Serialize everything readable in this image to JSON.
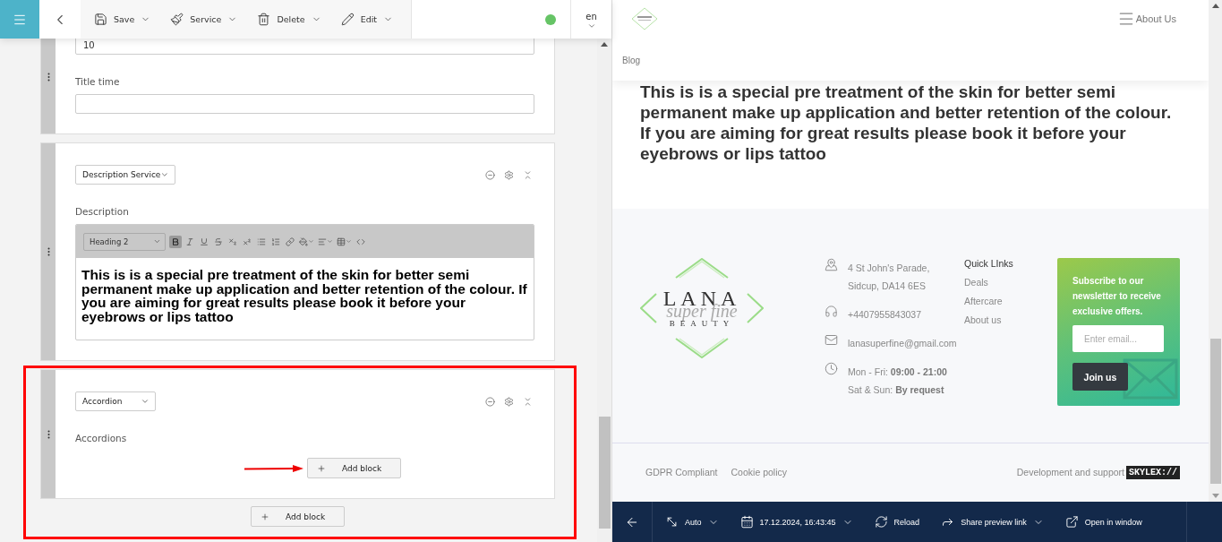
{
  "toolbar": {
    "actions": [
      {
        "kind": "save",
        "label": "Save"
      },
      {
        "kind": "service",
        "label": "Service"
      },
      {
        "kind": "delete",
        "label": "Delete"
      },
      {
        "kind": "edit",
        "label": "Edit"
      }
    ],
    "online": true,
    "language": "en"
  },
  "blocks": [
    {
      "kind": "fields",
      "fields": [
        {
          "value": "10"
        },
        {
          "label": "Title time"
        }
      ]
    },
    {
      "kind": "rich_text",
      "type": "Description Service",
      "label": "Description",
      "editor": {
        "format": "Heading 2",
        "bold_active": true,
        "content": "This is is a special pre treatment of the skin for better semi permanent make up application and better retention of the colour. If you are aiming for great results please book it before your eyebrows or lips tattoo"
      }
    },
    {
      "kind": "accordion",
      "type": "Accordion",
      "label": "Accordions",
      "add_button": "Add block",
      "highlighted": true
    }
  ],
  "add_block_button": "Add block",
  "preview": {
    "nav": {
      "menu_label": "About Us",
      "link": "Blog"
    },
    "heading": "This is is a special pre treatment of the skin for better semi permanent make up application and better retention of the colour. If you are aiming for great results please book it before your eyebrows or lips tattoo",
    "footer": {
      "logo": {
        "top": "LANA",
        "script": "super fine",
        "bottom": "BEAUTY"
      },
      "contacts": [
        {
          "kind": "address",
          "lines": [
            "4 St John's Parade,",
            "Sidcup, DA14 6ES"
          ]
        },
        {
          "kind": "phone",
          "lines": [
            "+4407955843037"
          ]
        },
        {
          "kind": "email",
          "lines": [
            "lanasuperfine@gmail.com"
          ]
        },
        {
          "kind": "hours",
          "lines": [
            "Mon - Fri: **09:00 - 21:00**",
            "Sat & Sun: **By request**"
          ]
        }
      ],
      "quick_links": {
        "title": "Quick LInks",
        "items": [
          "Deals",
          "Aftercare",
          "About us"
        ]
      },
      "newsletter": {
        "text": "Subscribe to our newsletter to receive exclusive offers.",
        "placeholder": "Enter email...",
        "button": "Join us"
      },
      "legal_links": [
        "GDPR Compliant",
        "Cookie policy"
      ],
      "credit": "Development and support",
      "credit_badge": "SKYLEX://"
    }
  },
  "preview_bar": {
    "items": [
      {
        "kind": "viewport",
        "label": "Auto",
        "dropdown": true
      },
      {
        "kind": "date",
        "label": "17.12.2024, 16:43:45",
        "dropdown": true
      },
      {
        "kind": "reload",
        "label": "Reload",
        "dropdown": false
      },
      {
        "kind": "share",
        "label": "Share preview link",
        "dropdown": true
      },
      {
        "kind": "open",
        "label": "Open in window",
        "dropdown": false
      }
    ]
  }
}
